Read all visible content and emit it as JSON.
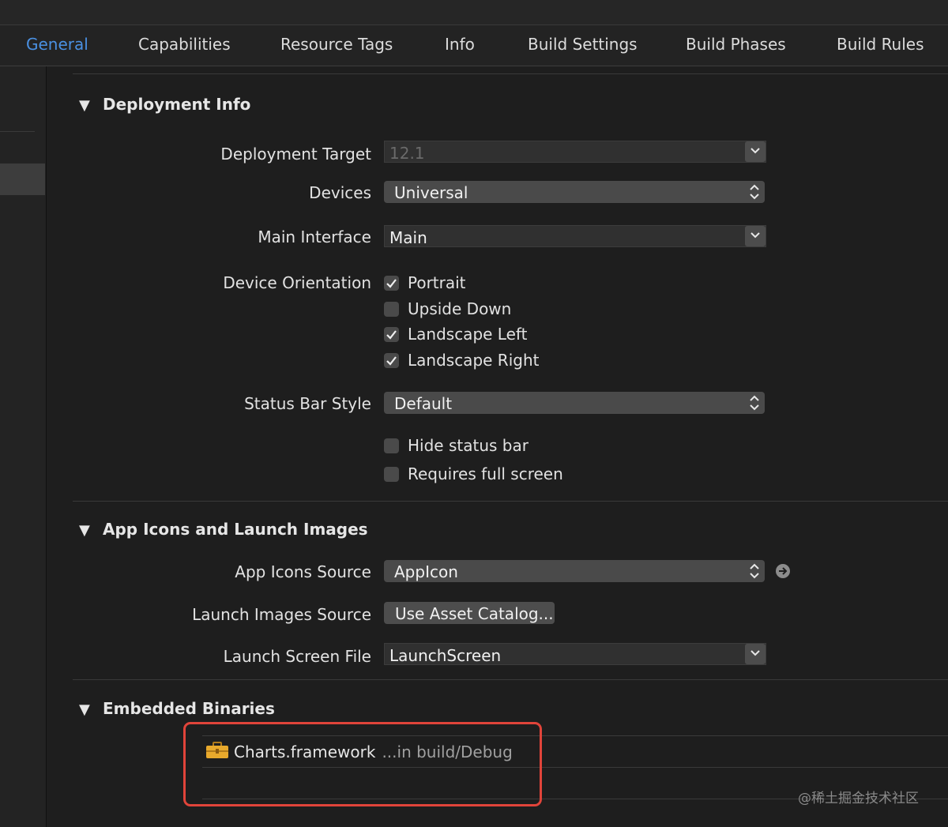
{
  "tabs": [
    {
      "label": "General",
      "active": true
    },
    {
      "label": "Capabilities"
    },
    {
      "label": "Resource Tags"
    },
    {
      "label": "Info"
    },
    {
      "label": "Build Settings"
    },
    {
      "label": "Build Phases"
    },
    {
      "label": "Build Rules"
    }
  ],
  "deployment": {
    "title": "Deployment Info",
    "target_label": "Deployment Target",
    "target_value": "12.1",
    "devices_label": "Devices",
    "devices_value": "Universal",
    "main_interface_label": "Main Interface",
    "main_interface_value": "Main",
    "orientation_label": "Device Orientation",
    "orientations": [
      {
        "label": "Portrait",
        "checked": true
      },
      {
        "label": "Upside Down",
        "checked": false
      },
      {
        "label": "Landscape Left",
        "checked": true
      },
      {
        "label": "Landscape Right",
        "checked": true
      }
    ],
    "status_bar_label": "Status Bar Style",
    "status_bar_value": "Default",
    "hide_status_bar": {
      "label": "Hide status bar",
      "checked": false
    },
    "requires_full_screen": {
      "label": "Requires full screen",
      "checked": false
    }
  },
  "app_icons": {
    "title": "App Icons and Launch Images",
    "icons_source_label": "App Icons Source",
    "icons_source_value": "AppIcon",
    "launch_images_label": "Launch Images Source",
    "launch_images_button": "Use Asset Catalog...",
    "launch_screen_label": "Launch Screen File",
    "launch_screen_value": "LaunchScreen"
  },
  "embedded": {
    "title": "Embedded Binaries",
    "items": [
      {
        "name": "Charts.framework",
        "path": "...in build/Debug",
        "icon": "toolbox-icon"
      }
    ]
  },
  "watermark": "@稀土掘金技术社区",
  "colors": {
    "accent": "#4a90e2",
    "highlight": "#e0443a"
  }
}
